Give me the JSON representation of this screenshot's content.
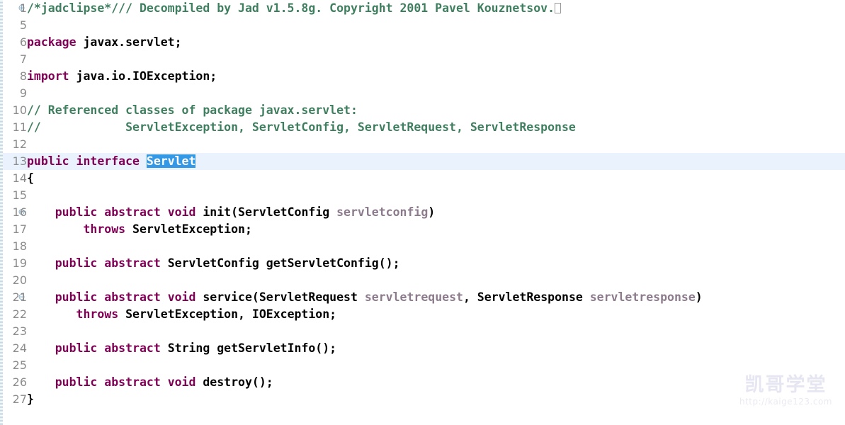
{
  "editor": {
    "language": "java",
    "file_kind": "decompiled-java-source",
    "current_line": 13,
    "selected_token": "Servlet",
    "colors": {
      "background": "#ffffff",
      "keyword": "#7f0055",
      "comment": "#3f7f5f",
      "plain_text": "#000000",
      "parameter": "#8c7b8c",
      "selection_background": "#3399e6",
      "selection_text": "#ffffff",
      "current_line_highlight": "#e9f2fd",
      "line_number": "#8c8c8c",
      "fold_marker": "#7fa8c4"
    },
    "fold_markers": {
      "collapsed": "⊕",
      "expanded": "⊖"
    },
    "lines": [
      {
        "number": "1",
        "fold": "collapsed",
        "current": false,
        "tokens": [
          {
            "style": "cmt",
            "text": "/*jadclipse*/// Decompiled by Jad v1.5.8g. Copyright 2001 Pavel Kouznetsov."
          },
          {
            "style": "nonprint",
            "text": ""
          }
        ]
      },
      {
        "number": "5",
        "fold": "none",
        "current": false,
        "tokens": []
      },
      {
        "number": "6",
        "fold": "none",
        "current": false,
        "tokens": [
          {
            "style": "kw",
            "text": "package"
          },
          {
            "style": "plain",
            "text": " javax.servlet;"
          }
        ]
      },
      {
        "number": "7",
        "fold": "none",
        "current": false,
        "tokens": []
      },
      {
        "number": "8",
        "fold": "none",
        "current": false,
        "tokens": [
          {
            "style": "kw",
            "text": "import"
          },
          {
            "style": "plain",
            "text": " java.io.IOException;"
          }
        ]
      },
      {
        "number": "9",
        "fold": "none",
        "current": false,
        "tokens": []
      },
      {
        "number": "10",
        "fold": "none",
        "current": false,
        "tokens": [
          {
            "style": "cmt",
            "text": "// Referenced classes of package javax.servlet:"
          }
        ]
      },
      {
        "number": "11",
        "fold": "none",
        "current": false,
        "tokens": [
          {
            "style": "cmt",
            "text": "//            ServletException, ServletConfig, ServletRequest, ServletResponse"
          }
        ]
      },
      {
        "number": "12",
        "fold": "none",
        "current": false,
        "tokens": []
      },
      {
        "number": "13",
        "fold": "none",
        "current": true,
        "tokens": [
          {
            "style": "kw",
            "text": "public interface "
          },
          {
            "style": "sel",
            "text": "Servlet"
          }
        ]
      },
      {
        "number": "14",
        "fold": "none",
        "current": false,
        "tokens": [
          {
            "style": "plain",
            "text": "{"
          }
        ]
      },
      {
        "number": "15",
        "fold": "none",
        "current": false,
        "tokens": []
      },
      {
        "number": "16",
        "fold": "expanded",
        "current": false,
        "tokens": [
          {
            "style": "plain",
            "text": "    "
          },
          {
            "style": "kw",
            "text": "public abstract void"
          },
          {
            "style": "plain",
            "text": " init(ServletConfig "
          },
          {
            "style": "param",
            "text": "servletconfig"
          },
          {
            "style": "plain",
            "text": ")"
          }
        ]
      },
      {
        "number": "17",
        "fold": "none",
        "current": false,
        "tokens": [
          {
            "style": "plain",
            "text": "        "
          },
          {
            "style": "kw",
            "text": "throws"
          },
          {
            "style": "plain",
            "text": " ServletException;"
          }
        ]
      },
      {
        "number": "18",
        "fold": "none",
        "current": false,
        "tokens": []
      },
      {
        "number": "19",
        "fold": "none",
        "current": false,
        "tokens": [
          {
            "style": "plain",
            "text": "    "
          },
          {
            "style": "kw",
            "text": "public abstract"
          },
          {
            "style": "plain",
            "text": " ServletConfig getServletConfig();"
          }
        ]
      },
      {
        "number": "20",
        "fold": "none",
        "current": false,
        "tokens": []
      },
      {
        "number": "21",
        "fold": "expanded",
        "current": false,
        "tokens": [
          {
            "style": "plain",
            "text": "    "
          },
          {
            "style": "kw",
            "text": "public abstract void"
          },
          {
            "style": "plain",
            "text": " service(ServletRequest "
          },
          {
            "style": "param",
            "text": "servletrequest"
          },
          {
            "style": "plain",
            "text": ", ServletResponse "
          },
          {
            "style": "param",
            "text": "servletresponse"
          },
          {
            "style": "plain",
            "text": ")"
          }
        ]
      },
      {
        "number": "22",
        "fold": "none",
        "current": false,
        "tokens": [
          {
            "style": "plain",
            "text": "       "
          },
          {
            "style": "kw",
            "text": "throws"
          },
          {
            "style": "plain",
            "text": " ServletException, IOException;"
          }
        ]
      },
      {
        "number": "23",
        "fold": "none",
        "current": false,
        "tokens": []
      },
      {
        "number": "24",
        "fold": "none",
        "current": false,
        "tokens": [
          {
            "style": "plain",
            "text": "    "
          },
          {
            "style": "kw",
            "text": "public abstract"
          },
          {
            "style": "plain",
            "text": " String getServletInfo();"
          }
        ]
      },
      {
        "number": "25",
        "fold": "none",
        "current": false,
        "tokens": []
      },
      {
        "number": "26",
        "fold": "none",
        "current": false,
        "tokens": [
          {
            "style": "plain",
            "text": "    "
          },
          {
            "style": "kw",
            "text": "public abstract void"
          },
          {
            "style": "plain",
            "text": " destroy();"
          }
        ]
      },
      {
        "number": "27",
        "fold": "none",
        "current": false,
        "tokens": [
          {
            "style": "plain",
            "text": "}"
          }
        ]
      },
      {
        "number": "",
        "fold": "none",
        "current": false,
        "tokens": []
      }
    ]
  },
  "watermark": {
    "text": "凯哥学堂",
    "url": "http://kaige123.com"
  }
}
